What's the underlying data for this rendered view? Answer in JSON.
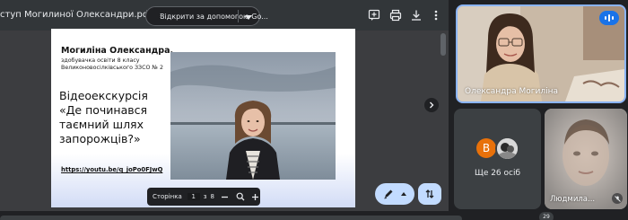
{
  "pdf_viewer": {
    "doc_title": "ступ Могилиної Олександри.pdf",
    "open_with_label": "Відкрити за допомогою Go...",
    "toolbar_icons": [
      "add-comment-icon",
      "print-icon",
      "download-icon",
      "more-vert-icon"
    ]
  },
  "slide": {
    "author_name": "Могиліна Олександра,",
    "author_desc": "здобувачка освіти 8 класу Великоновосілківського ЗЗСО № 2",
    "video_title": "Відеоекскурсія «Де починався таємний шлях запорожців?»",
    "link": "https://youtu.be/q_joPo0FJwQ"
  },
  "pager": {
    "label": "Сторінка",
    "current": "1",
    "sep": "з",
    "total": "8"
  },
  "participants": {
    "presenter_name": "Олександра Могиліна",
    "others_avatar_letter": "B",
    "others_label": "Ще 26 осіб",
    "third_name": "Людмила..."
  },
  "bottom": {
    "badge": "29"
  },
  "colors": {
    "background": "#202124",
    "pdf_toolbar": "#323639",
    "accent": "#8ab4f8",
    "fab": "#c2dbff",
    "mic_active": "#1a73e8",
    "avatar_orange": "#e8710a"
  }
}
